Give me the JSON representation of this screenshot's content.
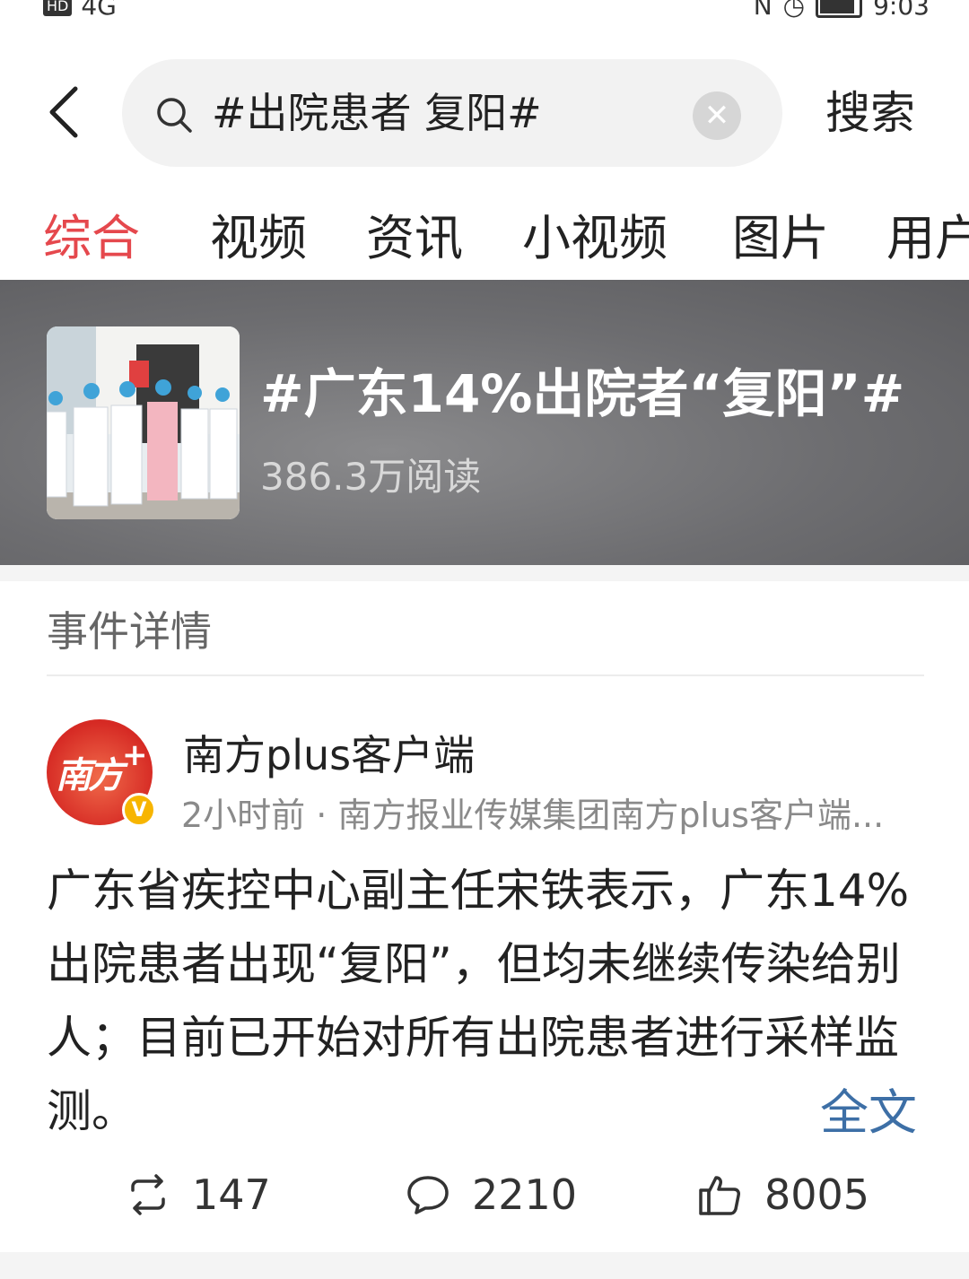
{
  "status_bar": {
    "hd_label": "HD",
    "signal_label": "4G",
    "time": "9:03"
  },
  "search": {
    "back_icon": "chevron-left-icon",
    "query": "#出院患者 复阳#",
    "clear_icon": "close-icon",
    "submit_label": "搜索"
  },
  "tabs": [
    {
      "label": "综合",
      "active": true
    },
    {
      "label": "视频",
      "active": false
    },
    {
      "label": "资讯",
      "active": false
    },
    {
      "label": "小视频",
      "active": false
    },
    {
      "label": "图片",
      "active": false
    },
    {
      "label": "用户",
      "active": false
    }
  ],
  "topic": {
    "title": "#广东14%出院者“复阳”#",
    "reads": "386.3万阅读"
  },
  "section": {
    "title": "事件详情"
  },
  "post": {
    "avatar_text": "南方",
    "avatar_plus": "+",
    "verified_badge": "V",
    "author": "南方plus客户端",
    "meta": "2小时前 · 南方报业传媒集团南方plus客户端...",
    "body": "广东省疾控中心副主任宋铁表示，广东14%出院患者出现“复阳”，但均未继续传染给别人；目前已开始对所有出院患者进行采样监测。",
    "read_more": "全文",
    "actions": {
      "repost_count": "147",
      "comment_count": "2210",
      "like_count": "8005"
    }
  },
  "colors": {
    "active_tab": "#e5484d",
    "link": "#3d6fa6",
    "banner_bg": "#6d6d70"
  }
}
